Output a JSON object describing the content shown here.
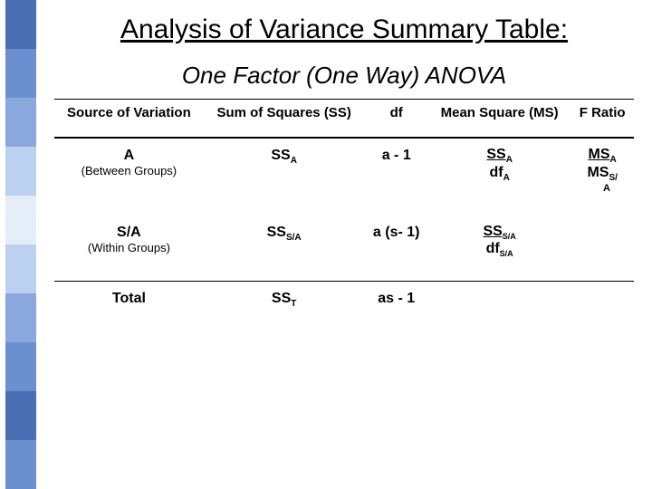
{
  "title": "Analysis of Variance Summary Table:",
  "subtitle": "One Factor (One Way) ANOVA",
  "headers": {
    "source": "Source of Variation",
    "ss": "Sum of Squares (SS)",
    "df": "df",
    "ms": "Mean Square (MS)",
    "f": "F Ratio"
  },
  "rows": {
    "a": {
      "source_l1": "A",
      "source_l2": "(Between Groups)",
      "ss_main": "SS",
      "ss_sub": "A",
      "df": "a - 1",
      "ms_top_main": "SS",
      "ms_top_sub": "A",
      "ms_bot_main": "df",
      "ms_bot_sub": "A",
      "f_top_main": "MS",
      "f_top_sub": "A",
      "f_bot_main": "MS",
      "f_bot_sub": "S/",
      "f_trail": "A"
    },
    "sa": {
      "source_l1": "S/A",
      "source_l2": "(Within Groups)",
      "ss_main": "SS",
      "ss_sub": "S/A",
      "df": "a (s- 1)",
      "ms_top_main": "SS",
      "ms_top_sub": "S/A",
      "ms_bot_main": "df",
      "ms_bot_sub": "S/A"
    },
    "total": {
      "source": "Total",
      "ss_main": "SS",
      "ss_sub": "T",
      "df": "as - 1"
    }
  },
  "chart_data": {
    "type": "table",
    "title": "Analysis of Variance Summary Table: One Factor (One Way) ANOVA",
    "columns": [
      "Source of Variation",
      "Sum of Squares (SS)",
      "df",
      "Mean Square (MS)",
      "F Ratio"
    ],
    "rows": [
      [
        "A (Between Groups)",
        "SS_A",
        "a - 1",
        "SS_A / df_A",
        "MS_A / MS_(S/A)"
      ],
      [
        "S/A (Within Groups)",
        "SS_(S/A)",
        "a (s - 1)",
        "SS_(S/A) / df_(S/A)",
        ""
      ],
      [
        "Total",
        "SS_T",
        "as - 1",
        "",
        ""
      ]
    ]
  }
}
